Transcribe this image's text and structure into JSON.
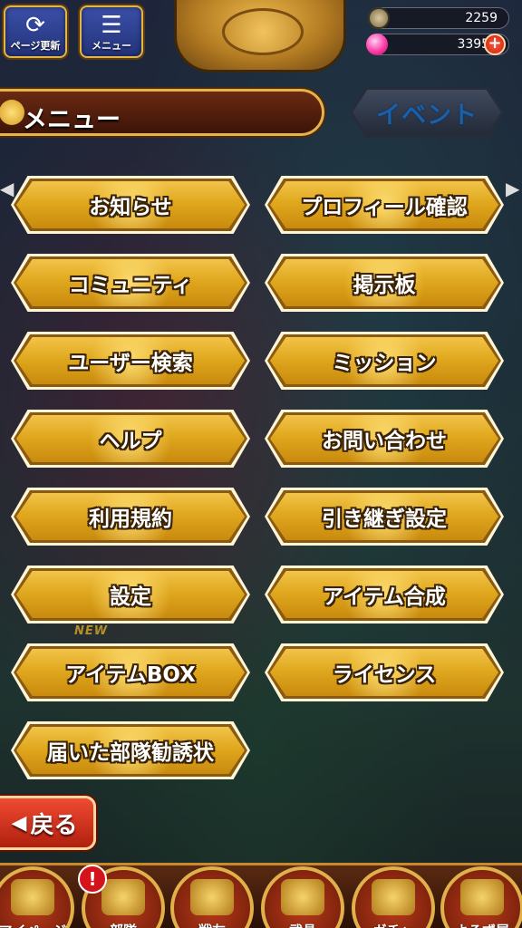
{
  "topbar": {
    "refresh_label": "ページ更新",
    "menu_label": "メニュー",
    "coins": "2259",
    "gems": "33950",
    "plus": "+"
  },
  "header": {
    "title": "メニュー",
    "event_label": "イベント"
  },
  "menu": {
    "items": [
      {
        "label": "お知らせ"
      },
      {
        "label": "プロフィール確認"
      },
      {
        "label": "コミュニティ"
      },
      {
        "label": "掲示板"
      },
      {
        "label": "ユーザー検索"
      },
      {
        "label": "ミッション"
      },
      {
        "label": "ヘルプ"
      },
      {
        "label": "お問い合わせ"
      },
      {
        "label": "利用規約"
      },
      {
        "label": "引き継ぎ設定"
      },
      {
        "label": "設定"
      },
      {
        "label": "アイテム合成"
      },
      {
        "label": "アイテムBOX"
      },
      {
        "label": "ライセンス"
      },
      {
        "label": "届いた部隊勧誘状"
      }
    ]
  },
  "new_badge": "NEW",
  "back_label": "戻る",
  "bottom_nav": {
    "items": [
      {
        "label": "マイページ",
        "icon": "palace-icon"
      },
      {
        "label": "部隊",
        "icon": "flag-icon"
      },
      {
        "label": "戦友",
        "icon": "warrior-icon"
      },
      {
        "label": "武具",
        "icon": "helmet-icon"
      },
      {
        "label": "ガチャ",
        "icon": "bowl-icon"
      },
      {
        "label": "よろず屋",
        "icon": "peach-icon"
      }
    ],
    "notification": "!"
  },
  "colors": {
    "button_gold": "#e0a81e",
    "back_red": "#d8321c",
    "event_blue": "#1a5fa8"
  }
}
